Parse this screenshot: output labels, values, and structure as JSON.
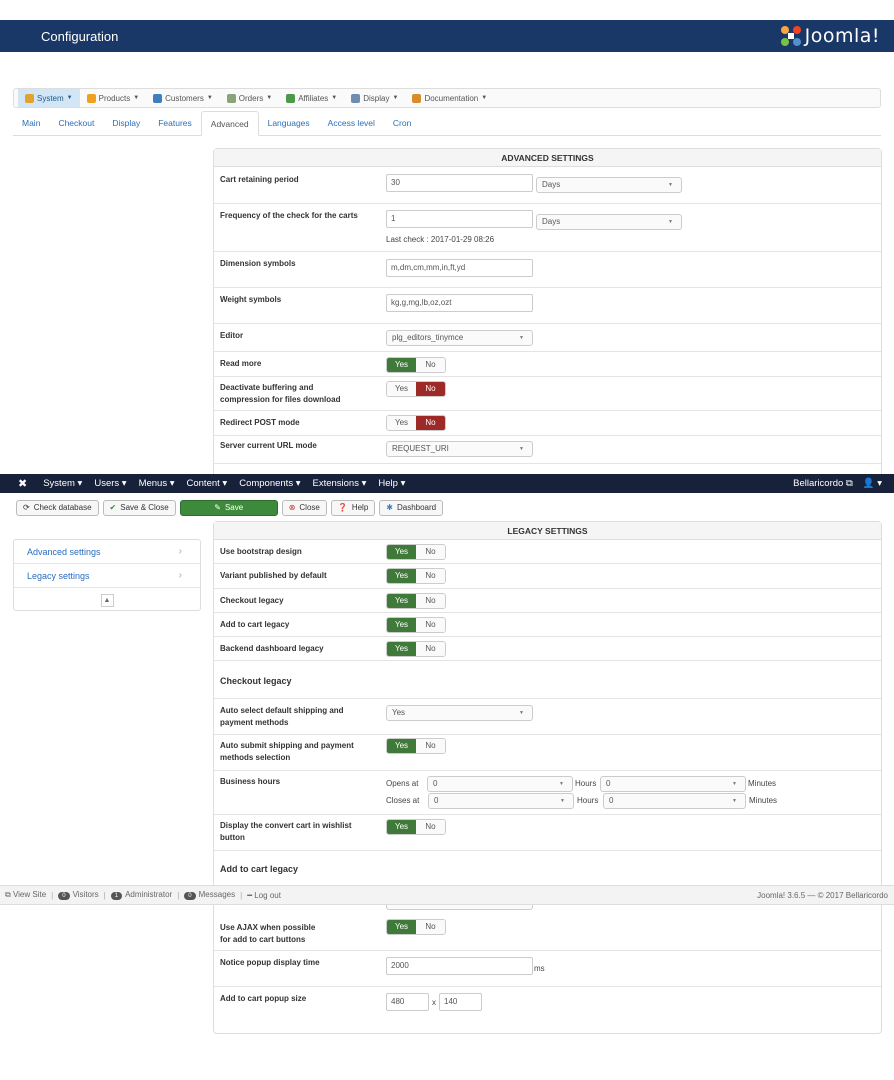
{
  "header": {
    "title": "Configuration",
    "brand": "Joomla!"
  },
  "hk_menu": [
    {
      "label": "System",
      "icon": "wrench-icon",
      "color": "#e2a32c",
      "active": true
    },
    {
      "label": "Products",
      "icon": "box-icon",
      "color": "#f0a020"
    },
    {
      "label": "Customers",
      "icon": "users-icon",
      "color": "#3d7fbf"
    },
    {
      "label": "Orders",
      "icon": "cart-icon",
      "color": "#8aa37a"
    },
    {
      "label": "Affiliates",
      "icon": "affiliates-icon",
      "color": "#4a9a4a"
    },
    {
      "label": "Display",
      "icon": "display-icon",
      "color": "#6d8db3"
    },
    {
      "label": "Documentation",
      "icon": "lifebuoy-icon",
      "color": "#d98d2a"
    }
  ],
  "config_tabs": [
    "Main",
    "Checkout",
    "Display",
    "Features",
    "Advanced",
    "Languages",
    "Access level",
    "Cron"
  ],
  "advanced": {
    "title": "ADVANCED SETTINGS",
    "cart_retaining": {
      "label": "Cart retaining period",
      "value": "30",
      "unit": "Days"
    },
    "frequency": {
      "label": "Frequency of the check for the carts",
      "value": "1",
      "unit": "Days",
      "last_check": "Last check : 2017-01-29 08:26"
    },
    "dimension": {
      "label": "Dimension symbols",
      "value": "m,dm,cm,mm,in,ft,yd"
    },
    "weight": {
      "label": "Weight symbols",
      "value": "kg,g,mg,lb,oz,ozt"
    },
    "editor": {
      "label": "Editor",
      "value": "plg_editors_tinymce"
    },
    "read_more": {
      "label": "Read more"
    },
    "deactivate": {
      "label1": "Deactivate buffering and",
      "label2": "compression for files download"
    },
    "redirect": {
      "label": "Redirect POST mode"
    },
    "server_url": {
      "label": "Server current URL mode",
      "value": "REQUEST_URI"
    }
  },
  "yes": "Yes",
  "no": "No",
  "admin_bar": {
    "menus": [
      "System",
      "Users",
      "Menus",
      "Content",
      "Components",
      "Extensions",
      "Help"
    ],
    "site": "Bellaricordo"
  },
  "toolbar": {
    "check_db": "Check database",
    "save_close": "Save & Close",
    "save": "Save",
    "close": "Close",
    "help": "Help",
    "dashboard": "Dashboard"
  },
  "sidenav": {
    "items": [
      "Advanced settings",
      "Legacy settings"
    ]
  },
  "legacy": {
    "title": "LEGACY SETTINGS",
    "bootstrap": "Use bootstrap design",
    "variant": "Variant published by default",
    "checkout_legacy": "Checkout legacy",
    "add_cart_legacy": "Add to cart legacy",
    "backend_dashboard": "Backend dashboard legacy",
    "section_checkout": "Checkout legacy",
    "auto_select": {
      "l1": "Auto select default shipping and",
      "l2": "payment methods",
      "value": "Yes"
    },
    "auto_submit": {
      "l1": "Auto submit shipping and payment",
      "l2": "methods selection"
    },
    "business": {
      "label": "Business hours",
      "opens": "Opens at",
      "closes": "Closes at",
      "hours": "Hours",
      "minutes": "Minutes",
      "zero": "0"
    },
    "convert": {
      "l1": "Display the convert cart in wishlist",
      "l2": "button"
    },
    "section_add": "Add to cart legacy",
    "ajax": {
      "l1": "Use AJAX when possible",
      "l2": "for add to cart buttons"
    },
    "notice": {
      "label": "Notice popup display time",
      "value": "2000",
      "unit": "ms"
    },
    "popup": {
      "label": "Add to cart popup size",
      "w": "480",
      "x": "x",
      "h": "140"
    }
  },
  "statusbar": {
    "view_site": "View Site",
    "visitors_count": "0",
    "visitors": "Visitors",
    "admin_count": "1",
    "admin": "Administrator",
    "msg_count": "0",
    "messages": "Messages",
    "logout": "Log out",
    "version": "Joomla! 3.6.5 — © 2017 Bellaricordo"
  }
}
